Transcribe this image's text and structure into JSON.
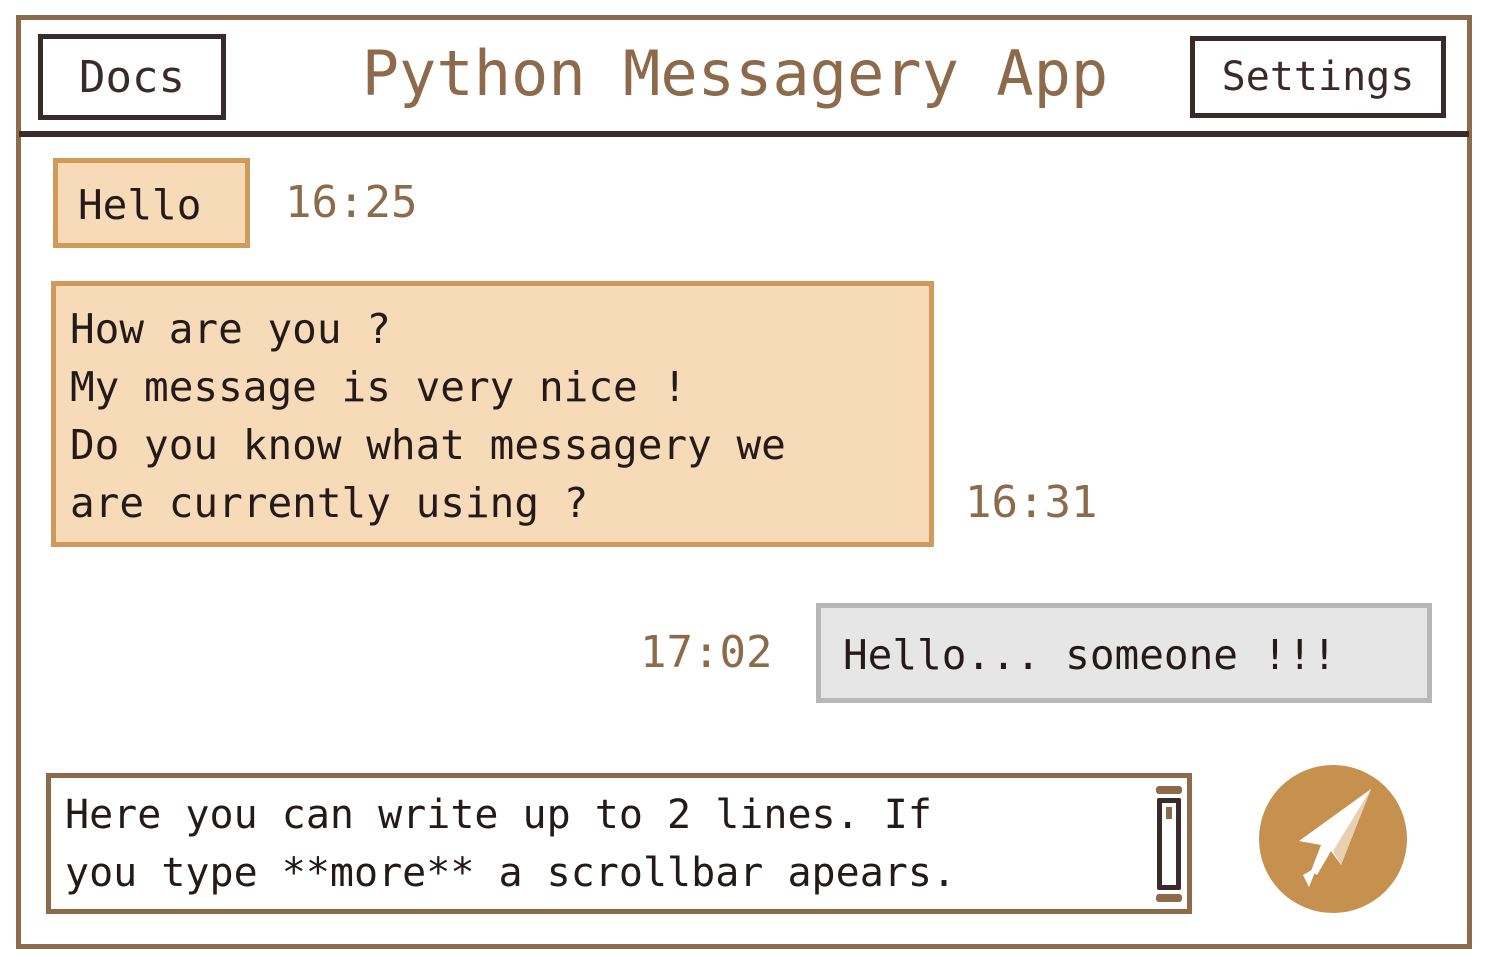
{
  "header": {
    "title": "Python Messagery App",
    "docs_label": "Docs",
    "settings_label": "Settings"
  },
  "messages": [
    {
      "direction": "incoming",
      "text": "Hello",
      "time": "16:25"
    },
    {
      "direction": "incoming",
      "text": "How are you ?\nMy message is very nice !\nDo you know what messagery we\nare currently using ?",
      "time": "16:31"
    },
    {
      "direction": "outgoing",
      "text": "Hello... someone !!!",
      "time": "17:02"
    }
  ],
  "composer": {
    "text": "Here you can write up to 2 lines. If\nyou type **more** a scrollbar apears."
  },
  "send_button": {
    "icon": "send-icon"
  },
  "colors": {
    "frame": "#8c6a4a",
    "header_line": "#3a2a2a",
    "incoming_bubble": "#f7dbb8",
    "incoming_border": "#cf9a5a",
    "outgoing_bubble": "#e6e6e6",
    "outgoing_border": "#b7b7b7",
    "send_button": "#c6914f"
  }
}
